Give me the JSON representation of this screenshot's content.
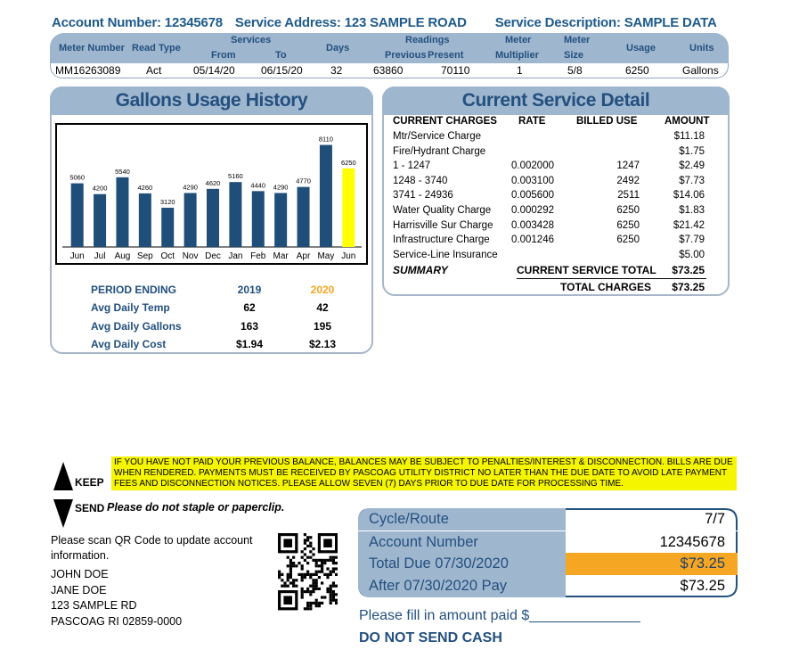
{
  "header": {
    "account_number": "Account Number: 12345678",
    "service_address": "Service Address: 123 SAMPLE ROAD",
    "service_description": "Service Description: SAMPLE DATA"
  },
  "meter_table": {
    "headers": {
      "meter_number": "Meter Number",
      "read_type": "Read Type",
      "services": "Services",
      "from": "From",
      "to": "To",
      "days": "Days",
      "readings": "Readings",
      "previous": "Previous",
      "present": "Present",
      "meter_multiplier_1": "Meter",
      "meter_multiplier_2": "Multiplier",
      "meter_size_1": "Meter",
      "meter_size_2": "Size",
      "usage": "Usage",
      "units": "Units"
    },
    "row": {
      "meter_number": "MM16263089",
      "read_type": "Act",
      "from": "05/14/20",
      "to": "06/15/20",
      "days": "32",
      "previous": "63860",
      "present": "70110",
      "multiplier": "1",
      "size": "5/8",
      "usage": "6250",
      "units": "Gallons"
    }
  },
  "usage_history": {
    "title": "Gallons Usage History",
    "stats": {
      "period_ending": "PERIOD ENDING",
      "year_prev": "2019",
      "year_curr": "2020",
      "rows": [
        {
          "label": "Avg Daily Temp",
          "prev": "62",
          "curr": "42"
        },
        {
          "label": "Avg Daily Gallons",
          "prev": "163",
          "curr": "195"
        },
        {
          "label": "Avg Daily Cost",
          "prev": "$1.94",
          "curr": "$2.13"
        }
      ]
    }
  },
  "chart_data": {
    "type": "bar",
    "title": "Gallons Usage History",
    "categories": [
      "Jun",
      "Jul",
      "Aug",
      "Sep",
      "Oct",
      "Nov",
      "Dec",
      "Jan",
      "Feb",
      "Mar",
      "Apr",
      "May",
      "Jun"
    ],
    "values": [
      5060,
      4200,
      5540,
      4260,
      3120,
      4290,
      4620,
      5160,
      4440,
      4290,
      4770,
      8110,
      6250
    ],
    "highlight_index": 12,
    "bar_color": "#1f4e79",
    "highlight_color": "#ffff00",
    "ylim": [
      0,
      9000
    ],
    "grid": false,
    "xlabel": "",
    "ylabel": ""
  },
  "service_detail": {
    "title": "Current Service Detail",
    "col_charges": "CURRENT CHARGES",
    "col_rate": "RATE",
    "col_billed": "BILLED USE",
    "col_amount": "AMOUNT",
    "rows": [
      {
        "name": "Mtr/Service Charge",
        "rate": "",
        "billed": "",
        "amount": "$11.18"
      },
      {
        "name": "Fire/Hydrant Charge",
        "rate": "",
        "billed": "",
        "amount": "$1.75"
      },
      {
        "name": "1 - 1247",
        "rate": "0.002000",
        "billed": "1247",
        "amount": "$2.49"
      },
      {
        "name": "1248 - 3740",
        "rate": "0.003100",
        "billed": "2492",
        "amount": "$7.73"
      },
      {
        "name": "3741 - 24936",
        "rate": "0.005600",
        "billed": "2511",
        "amount": "$14.06"
      },
      {
        "name": "Water Quality Charge",
        "rate": "0.000292",
        "billed": "6250",
        "amount": "$1.83"
      },
      {
        "name": "Harrisville Sur Charge",
        "rate": "0.003428",
        "billed": "6250",
        "amount": "$21.42"
      },
      {
        "name": "Infrastructure Charge",
        "rate": "0.001246",
        "billed": "6250",
        "amount": "$7.79"
      },
      {
        "name": "Service-Line Insurance",
        "rate": "",
        "billed": "",
        "amount": "$5.00"
      }
    ],
    "summary_label": "SUMMARY",
    "current_total_label": "CURRENT SERVICE TOTAL",
    "current_total": "$73.25",
    "total_charges_label": "TOTAL CHARGES",
    "total_charges": "$73.25"
  },
  "notice": {
    "text": "IF YOU HAVE NOT PAID YOUR PREVIOUS BALANCE, BALANCES MAY BE SUBJECT TO PENALTIES/INTEREST & DISCONNECTION. BILLS ARE DUE WHEN RENDERED. PAYMENTS MUST BE RECEIVED BY PASCOAG UTILITY DISTRICT NO LATER THAN THE DUE DATE TO AVOID LATE PAYMENT FEES AND DISCONNECTION NOTICES.  PLEASE ALLOW SEVEN (7) DAYS PRIOR TO DUE DATE FOR PROCESSING TIME.",
    "keep": "KEEP",
    "send": "SEND",
    "staple": "Please do not staple or paperclip."
  },
  "mailing": {
    "qr_note": "Please scan QR Code to update account information.",
    "lines": [
      "JOHN DOE",
      "JANE DOE",
      "123 SAMPLE RD",
      "PASCOAG RI 02859-0000"
    ]
  },
  "stub": {
    "rows": [
      {
        "label": "Cycle/Route",
        "value": "7/7"
      },
      {
        "label": "Account Number",
        "value": "12345678"
      },
      {
        "label": "Total Due 07/30/2020",
        "value": "$73.25"
      },
      {
        "label": "After 07/30/2020 Pay",
        "value": "$73.25"
      }
    ],
    "highlight_color": "#f5a623",
    "fill_in": "Please fill in amount paid $______________",
    "no_cash": "DO NOT SEND CASH"
  }
}
